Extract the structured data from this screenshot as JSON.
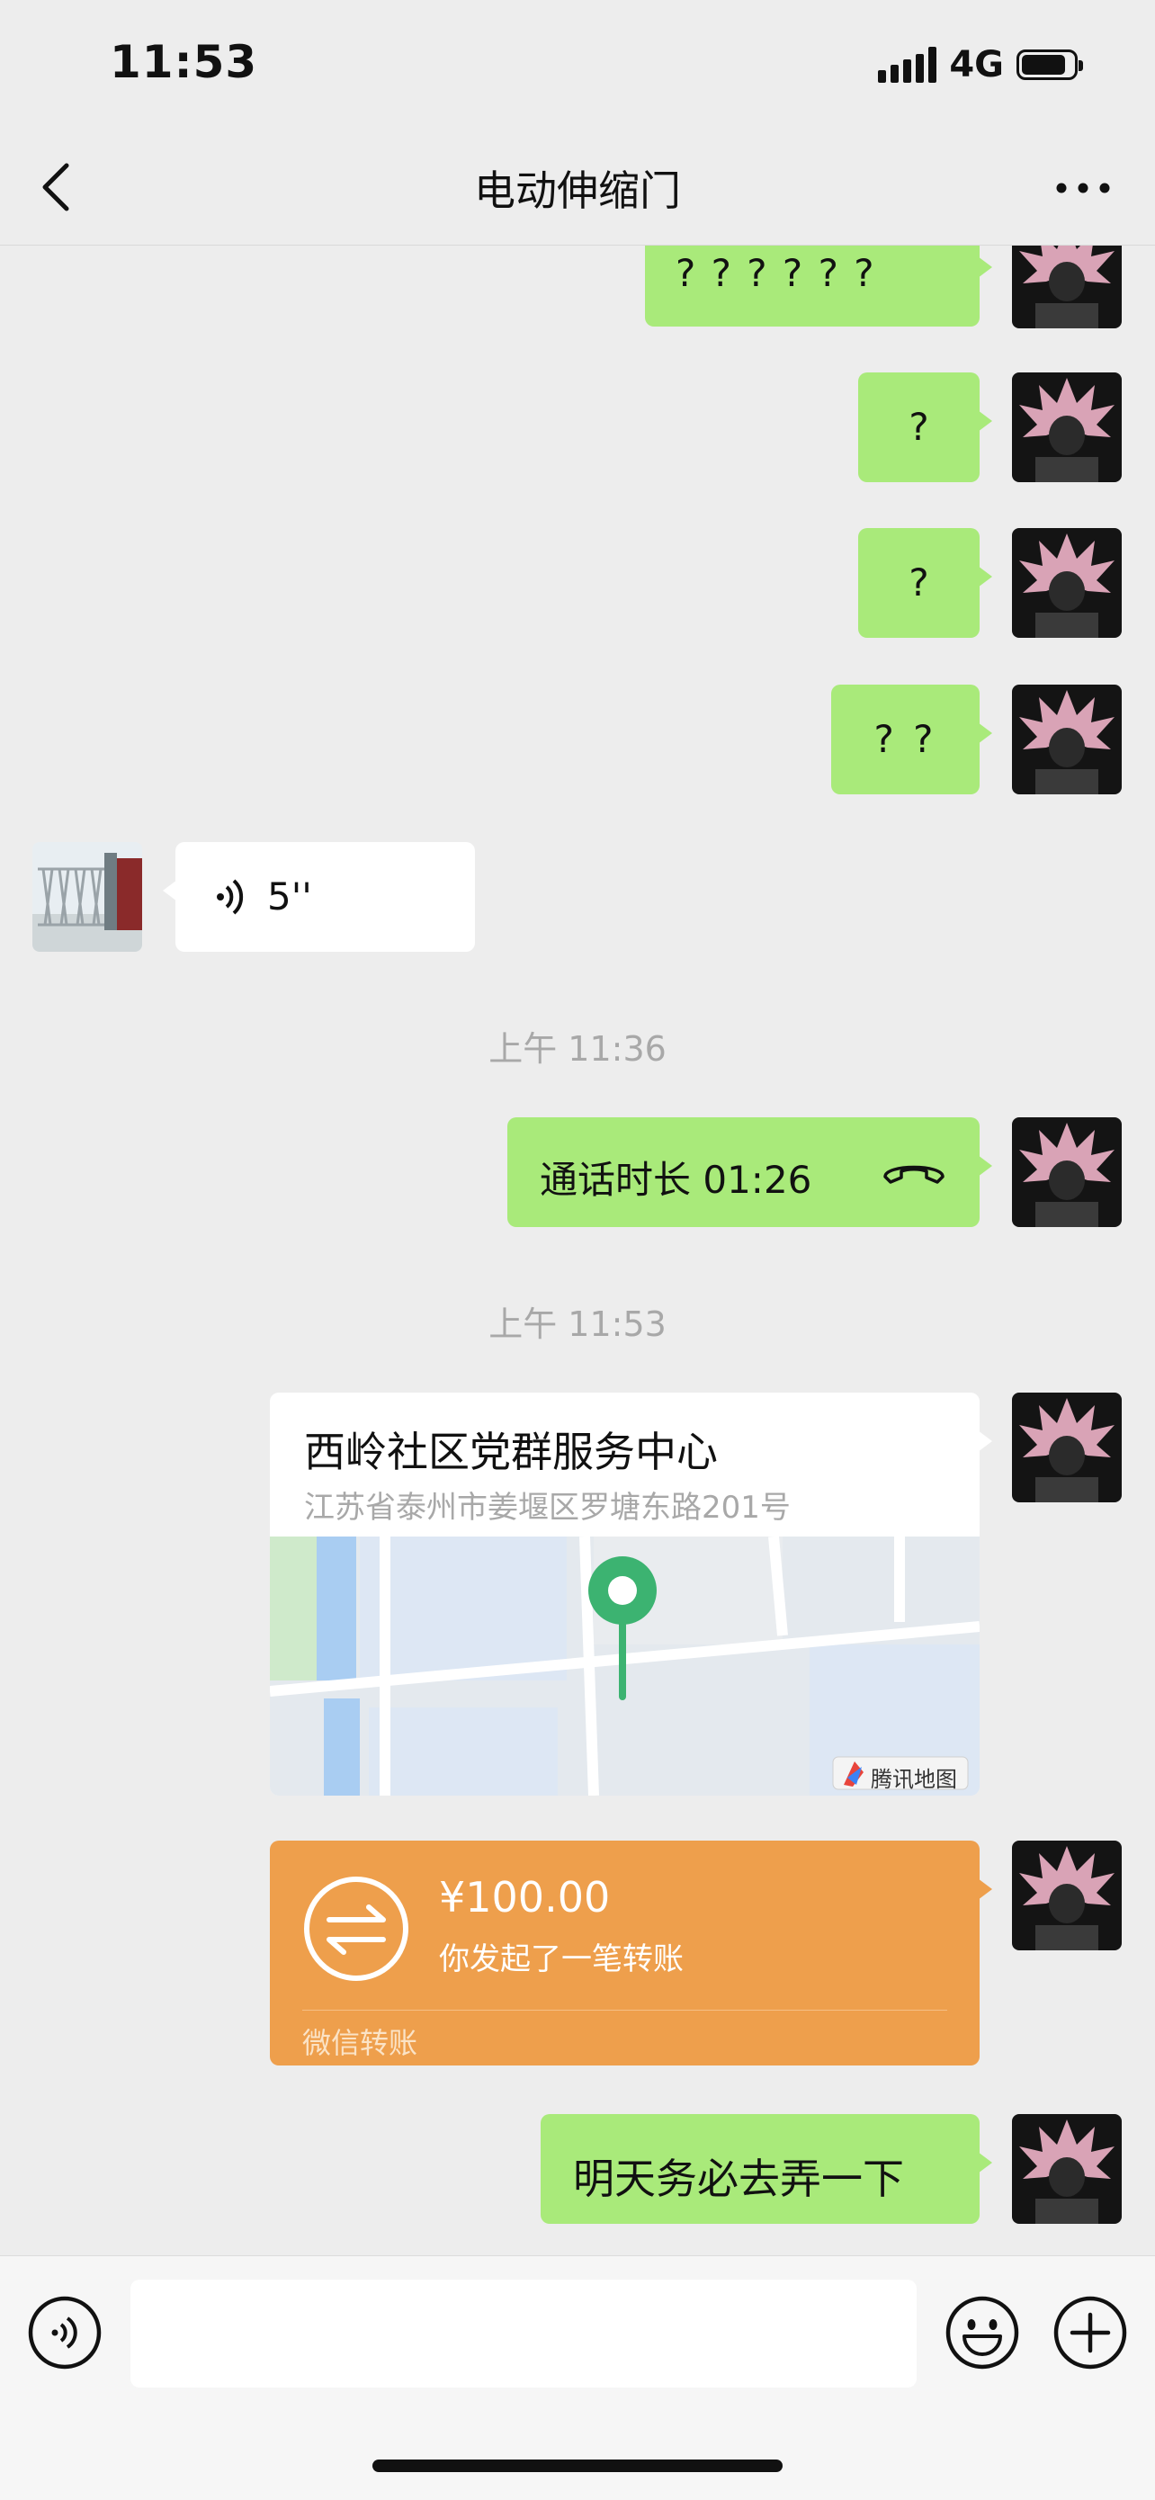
{
  "status_bar": {
    "time": "11:53",
    "network": "4G"
  },
  "header": {
    "title": "电动伸缩门"
  },
  "messages": {
    "q6": "? ? ? ? ? ?",
    "q1a": "?",
    "q1b": "?",
    "q2": "? ?",
    "voice_duration": "5''",
    "timestamp1": "上午 11:36",
    "call": "通话时长 01:26",
    "timestamp2": "上午 11:53",
    "location": {
      "name": "西岭社区党群服务中心",
      "address": "江苏省泰州市姜堰区罗塘东路201号",
      "map_brand": "腾讯地图"
    },
    "transfer": {
      "amount": "¥100.00",
      "description": "你发起了一笔转账",
      "footer": "微信转账"
    },
    "last": "明天务必去弄一下"
  },
  "colors": {
    "bubble_green": "#a9ea7a",
    "transfer_orange": "#ee9f4c",
    "map_pin": "#3cb371"
  }
}
